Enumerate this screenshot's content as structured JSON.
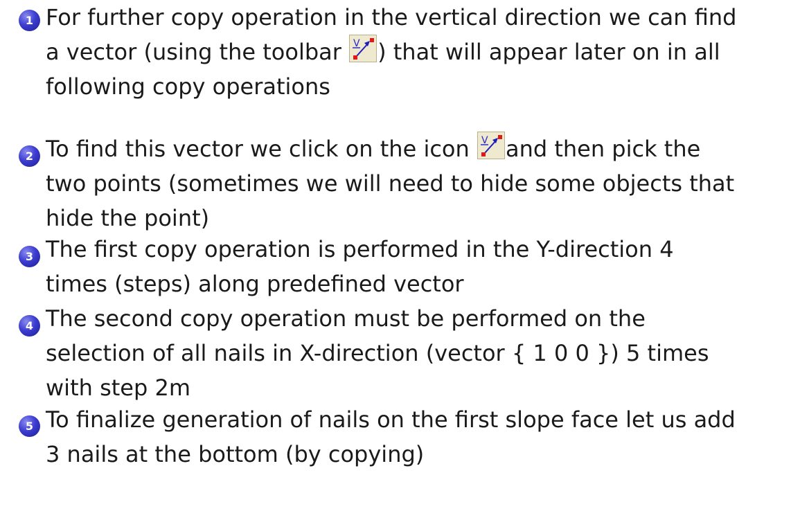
{
  "items": [
    {
      "number": "1",
      "lines": [
        [
          "For further copy operation in the vertical direction we can find"
        ],
        [
          "a vector (using the toolbar ",
          "ICON",
          ") that will appear later on in all"
        ],
        [
          "following copy operations"
        ]
      ]
    },
    {
      "number": "2",
      "lines": [
        [
          "To find this vector we click on the icon ",
          "ICON",
          "and then pick the"
        ],
        [
          "two points (sometimes we will need to hide some objects that"
        ],
        [
          "hide the point)"
        ]
      ]
    },
    {
      "number": "3",
      "lines": [
        [
          "The first copy operation is performed in the Y-direction 4"
        ],
        [
          "times (steps) along predefined vector"
        ]
      ]
    },
    {
      "number": "4",
      "lines": [
        [
          "The second copy operation must be performed on the"
        ],
        [
          "selection of all nails in X-direction (vector { 1 0 0 }) 5 times"
        ],
        [
          "with step 2m"
        ]
      ]
    },
    {
      "number": "5",
      "lines": [
        [
          "To finalize generation of nails on the first slope face let us add"
        ],
        [
          "3 nails at the bottom (by copying)"
        ]
      ]
    }
  ],
  "icon": {
    "name": "vector-tool-icon",
    "label": "V"
  }
}
